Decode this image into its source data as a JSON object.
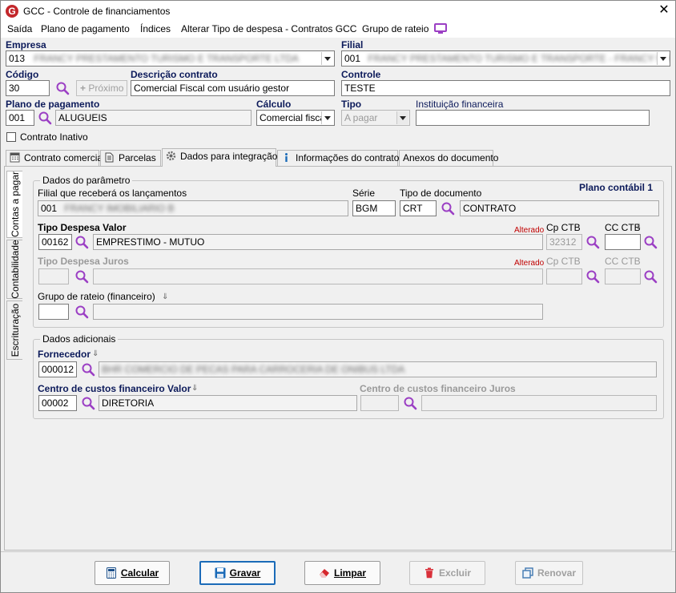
{
  "window": {
    "title": "GCC - Controle de financiamentos",
    "app_icon_letter": "G",
    "close": "✕"
  },
  "menu": {
    "items": [
      "Saída",
      "Plano de pagamento",
      "Índices",
      "Alterar Tipo de despesa - Contratos GCC",
      "Grupo de rateio"
    ]
  },
  "form": {
    "empresa": {
      "label": "Empresa",
      "value": "013",
      "blurred": "FRANCY PRESTAMENTO TURISMO E TRANSPORTE LTDA"
    },
    "filial": {
      "label": "Filial",
      "value": "001",
      "blurred": "FRANCY PRESTAMENTO TURISMO E TRANSPORTE - FRANCY MATRIZ"
    },
    "codigo": {
      "label": "Código",
      "value": "30"
    },
    "proximo": {
      "label": "Próximo",
      "icon": "+"
    },
    "descricao": {
      "label": "Descrição contrato",
      "value": "Comercial Fiscal com usuário gestor"
    },
    "controle": {
      "label": "Controle",
      "value": "TESTE"
    },
    "plano": {
      "label": "Plano de pagamento",
      "code": "001",
      "value": "ALUGUEIS"
    },
    "calculo": {
      "label": "Cálculo",
      "value": "Comercial fiscal"
    },
    "tipo": {
      "label": "Tipo",
      "value": "A pagar"
    },
    "instituicao": {
      "label": "Instituição financeira",
      "value": ""
    },
    "inativo": {
      "label": "Contrato Inativo",
      "checked": false
    }
  },
  "tabs": [
    {
      "label": "Contrato comercial",
      "active": false
    },
    {
      "label": "Parcelas",
      "active": false
    },
    {
      "label": "Dados para integração",
      "active": true
    },
    {
      "label": "Informações do contrato",
      "active": false
    },
    {
      "label": "Anexos do documento",
      "active": false
    }
  ],
  "vtabs": [
    "Contas a pagar",
    "Contabilidade",
    "Escrituração"
  ],
  "param": {
    "group_title": "Dados do parâmetro",
    "filial_label": "Filial que receberá os lançamentos",
    "filial_value": "001",
    "filial_blurred": "FRANCY IMOBILIARIO B",
    "serie_label": "Série",
    "serie_value": "BGM",
    "tipo_doc_label": "Tipo de documento",
    "tipo_doc_code": "CRT",
    "tipo_doc_value": "CONTRATO",
    "plano_contabil": "Plano contábil 1",
    "despesa_valor_label": "Tipo Despesa Valor",
    "despesa_valor_code": "00162",
    "despesa_valor_value": "EMPRESTIMO - MUTUO",
    "alterado": "Alterado",
    "cp_ctb_label": "Cp CTB",
    "cp_ctb_value": "32312",
    "cc_ctb_label": "CC CTB",
    "despesa_juros_label": "Tipo Despesa Juros",
    "grupo_rateio_label": "Grupo de rateio (financeiro)"
  },
  "adicionais": {
    "group_title": "Dados adicionais",
    "fornecedor_label": "Fornecedor",
    "fornecedor_code": "000012",
    "fornecedor_blurred": "BHR COMERCIO DE PECAS PARA CARROCERIA DE ONIBUS LTDA",
    "cc_valor_label": "Centro de custos financeiro Valor",
    "cc_valor_code": "00002",
    "cc_valor_value": "DIRETORIA",
    "cc_juros_label": "Centro de custos financeiro Juros"
  },
  "buttons": {
    "calcular": "Calcular",
    "gravar": "Gravar",
    "limpar": "Limpar",
    "excluir": "Excluir",
    "renovar": "Renovar"
  },
  "colors": {
    "label_blue": "#0c1a5a",
    "accent_purple": "#9b3fc4",
    "alterado_red": "#c00000",
    "primary_border": "#1b6bb8"
  }
}
